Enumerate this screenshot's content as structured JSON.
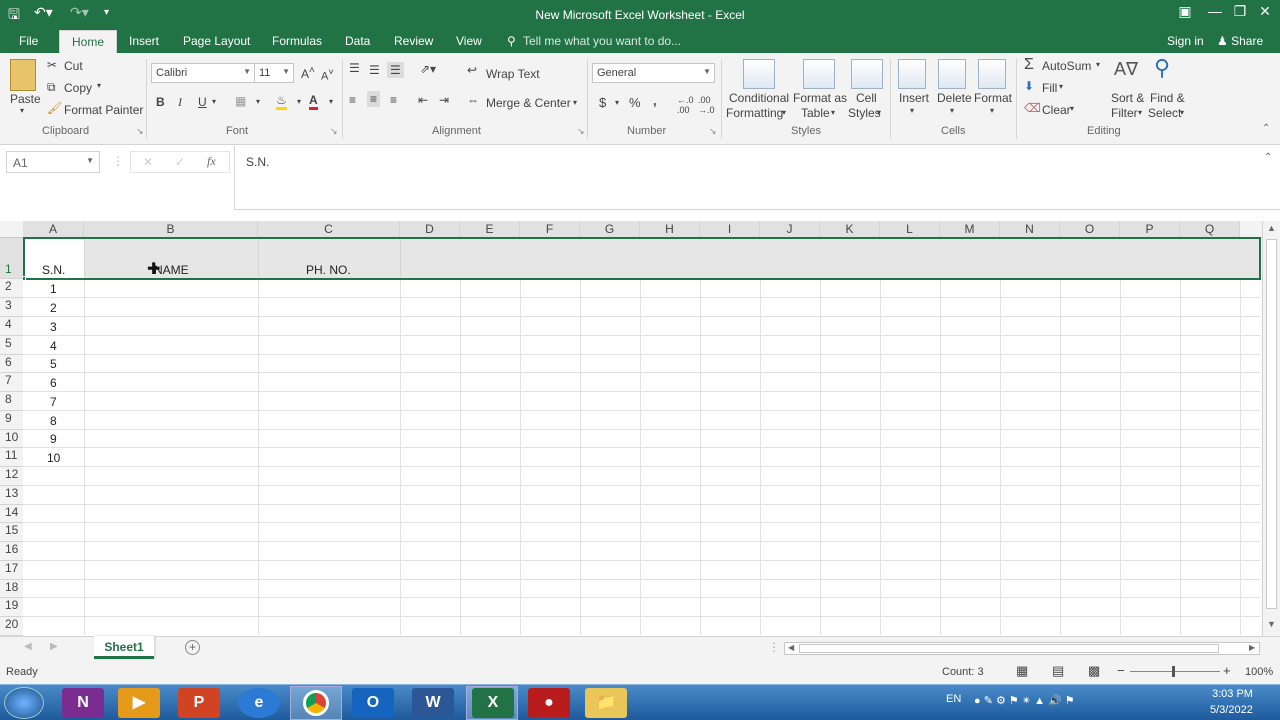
{
  "window": {
    "title": "New Microsoft Excel Worksheet - Excel"
  },
  "tabs": [
    "File",
    "Home",
    "Insert",
    "Page Layout",
    "Formulas",
    "Data",
    "Review",
    "View"
  ],
  "tell_me": "Tell me what you want to do...",
  "account": {
    "signin": "Sign in",
    "share": "Share"
  },
  "ribbon": {
    "clipboard": {
      "paste": "Paste",
      "cut": "Cut",
      "copy": "Copy",
      "format_painter": "Format Painter",
      "label": "Clipboard"
    },
    "font": {
      "name": "Calibri",
      "size": "11",
      "label": "Font",
      "bold": "B",
      "italic": "I",
      "underline": "U"
    },
    "alignment": {
      "wrap": "Wrap Text",
      "merge": "Merge & Center",
      "label": "Alignment"
    },
    "number": {
      "format": "General",
      "label": "Number",
      "currency": "$",
      "percent": "%",
      "comma": ","
    },
    "styles": {
      "conditional": "Conditional",
      "conditional2": "Formatting",
      "format_table": "Format as",
      "format_table2": "Table",
      "cell_styles": "Cell",
      "cell_styles2": "Styles",
      "label": "Styles"
    },
    "cells": {
      "insert": "Insert",
      "delete": "Delete",
      "format": "Format",
      "label": "Cells"
    },
    "editing": {
      "autosum": "AutoSum",
      "fill": "Fill",
      "clear": "Clear",
      "sort": "Sort &",
      "sort2": "Filter",
      "find": "Find &",
      "find2": "Select",
      "label": "Editing"
    }
  },
  "formula": {
    "namebox": "A1",
    "fx": "fx",
    "content": "S.N."
  },
  "columns": [
    "A",
    "B",
    "C",
    "D",
    "E",
    "F",
    "G",
    "H",
    "I",
    "J",
    "K",
    "L",
    "M",
    "N",
    "O",
    "P",
    "Q"
  ],
  "rows": [
    "1",
    "2",
    "3",
    "4",
    "5",
    "6",
    "7",
    "8",
    "9",
    "10",
    "11",
    "12",
    "13",
    "14",
    "15",
    "16",
    "17",
    "18",
    "19",
    "20"
  ],
  "cells": {
    "A1": "S.N.",
    "B1": "NAME",
    "C1": "PH. NO.",
    "A_values": [
      "1",
      "2",
      "3",
      "4",
      "5",
      "6",
      "7",
      "8",
      "9",
      "10"
    ]
  },
  "sheet": {
    "name": "Sheet1"
  },
  "status": {
    "ready": "Ready",
    "count": "Count: 3",
    "zoom": "100%"
  },
  "taskbar": {
    "lang": "EN",
    "time": "3:03 PM",
    "date": "5/3/2022"
  }
}
